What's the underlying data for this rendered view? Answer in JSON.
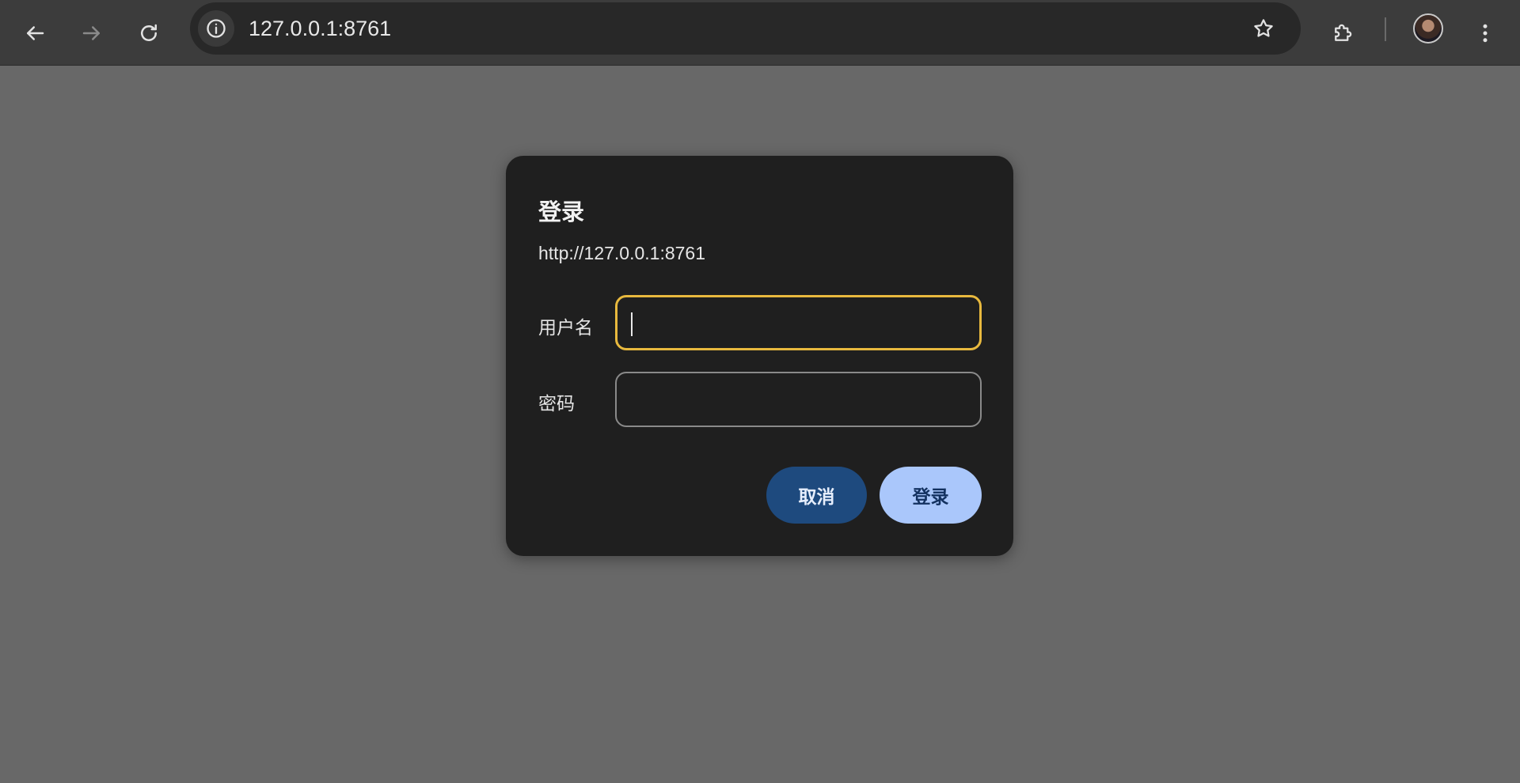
{
  "toolbar": {
    "back_icon": "arrow-left-icon",
    "forward_icon": "arrow-right-icon",
    "reload_icon": "reload-icon",
    "site_info_icon": "info-icon",
    "url": "127.0.0.1:8761",
    "bookmark_icon": "star-icon",
    "extensions_icon": "puzzle-icon",
    "menu_icon": "kebab-menu-icon"
  },
  "dialog": {
    "title": "登录",
    "origin": "http://127.0.0.1:8761",
    "username_label": "用户名",
    "username_value": "",
    "password_label": "密码",
    "password_value": "",
    "cancel_label": "取消",
    "login_label": "登录"
  },
  "colors": {
    "page_background": "#686868",
    "toolbar_background": "#3c3c3c",
    "dialog_background": "#1f1f1f",
    "focus_ring": "#e8b93e",
    "cancel_button": "#1e4a7e",
    "login_button": "#aac7fb"
  }
}
